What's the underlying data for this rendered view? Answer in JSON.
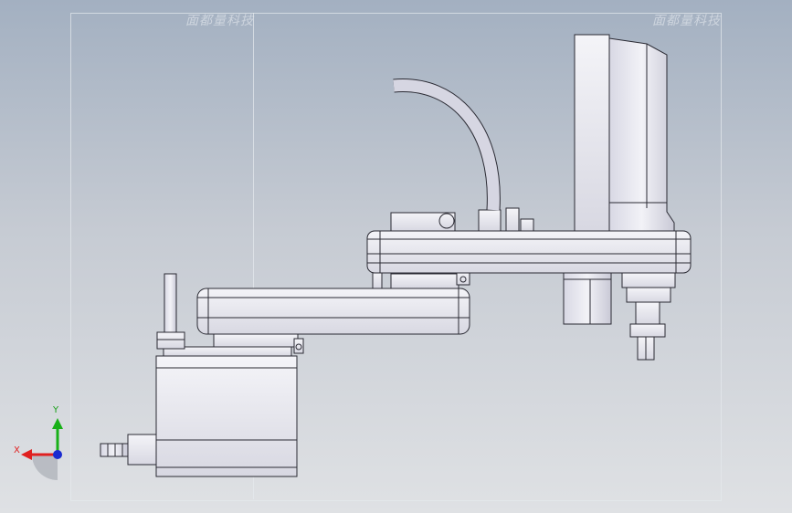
{
  "watermark": {
    "left": "面都量科技",
    "right": "面都量科技"
  },
  "triad": {
    "x_label": "X",
    "y_label": "Y"
  },
  "colors": {
    "x_axis": "#e02020",
    "y_axis": "#18b018",
    "z_axis": "#1a2bd0",
    "part": "#e6e6ee",
    "edge": "#2a2a33"
  }
}
